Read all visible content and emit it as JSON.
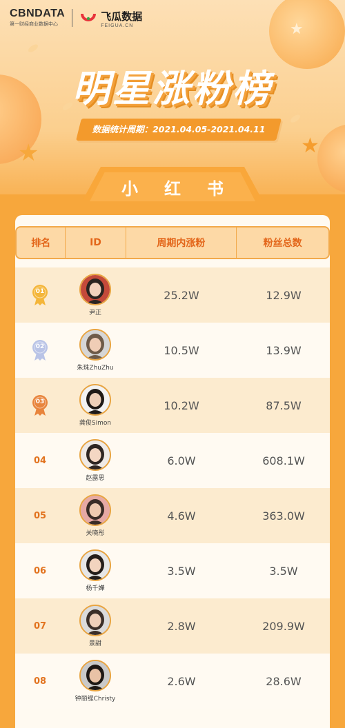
{
  "header": {
    "cbn_brand": "CBNDATA",
    "cbn_sub": "第一财经商业数据中心",
    "feigua_name": "飞瓜数据",
    "feigua_url": "FEIGUA.CN"
  },
  "title": "明星涨粉榜",
  "period": "数据统计周期：2021.04.05-2021.04.11",
  "platform_tab": "小红书",
  "table": {
    "headers": [
      "排名",
      "ID",
      "周期内涨粉",
      "粉丝总数"
    ],
    "rows": [
      {
        "rank": "01",
        "name": "尹正",
        "growth": "25.2W",
        "total": "12.9W",
        "medal": "gold"
      },
      {
        "rank": "02",
        "name": "朱珠ZhuZhu",
        "growth": "10.5W",
        "total": "13.9W",
        "medal": "silver"
      },
      {
        "rank": "03",
        "name": "龚俊Simon",
        "growth": "10.2W",
        "total": "87.5W",
        "medal": "bronze"
      },
      {
        "rank": "04",
        "name": "赵露思",
        "growth": "6.0W",
        "total": "608.1W",
        "medal": ""
      },
      {
        "rank": "05",
        "name": "关晓彤",
        "growth": "4.6W",
        "total": "363.0W",
        "medal": ""
      },
      {
        "rank": "06",
        "name": "杨千嬅",
        "growth": "3.5W",
        "total": "3.5W",
        "medal": ""
      },
      {
        "rank": "07",
        "name": "景甜",
        "growth": "2.8W",
        "total": "209.9W",
        "medal": ""
      },
      {
        "rank": "08",
        "name": "钟丽缇Christy",
        "growth": "2.6W",
        "total": "28.6W",
        "medal": ""
      }
    ]
  },
  "colors": {
    "accent": "#f7a536",
    "header_text": "#e3661a",
    "gold": "#f4b63a",
    "silver": "#b9c3e6",
    "bronze": "#e8843c"
  }
}
